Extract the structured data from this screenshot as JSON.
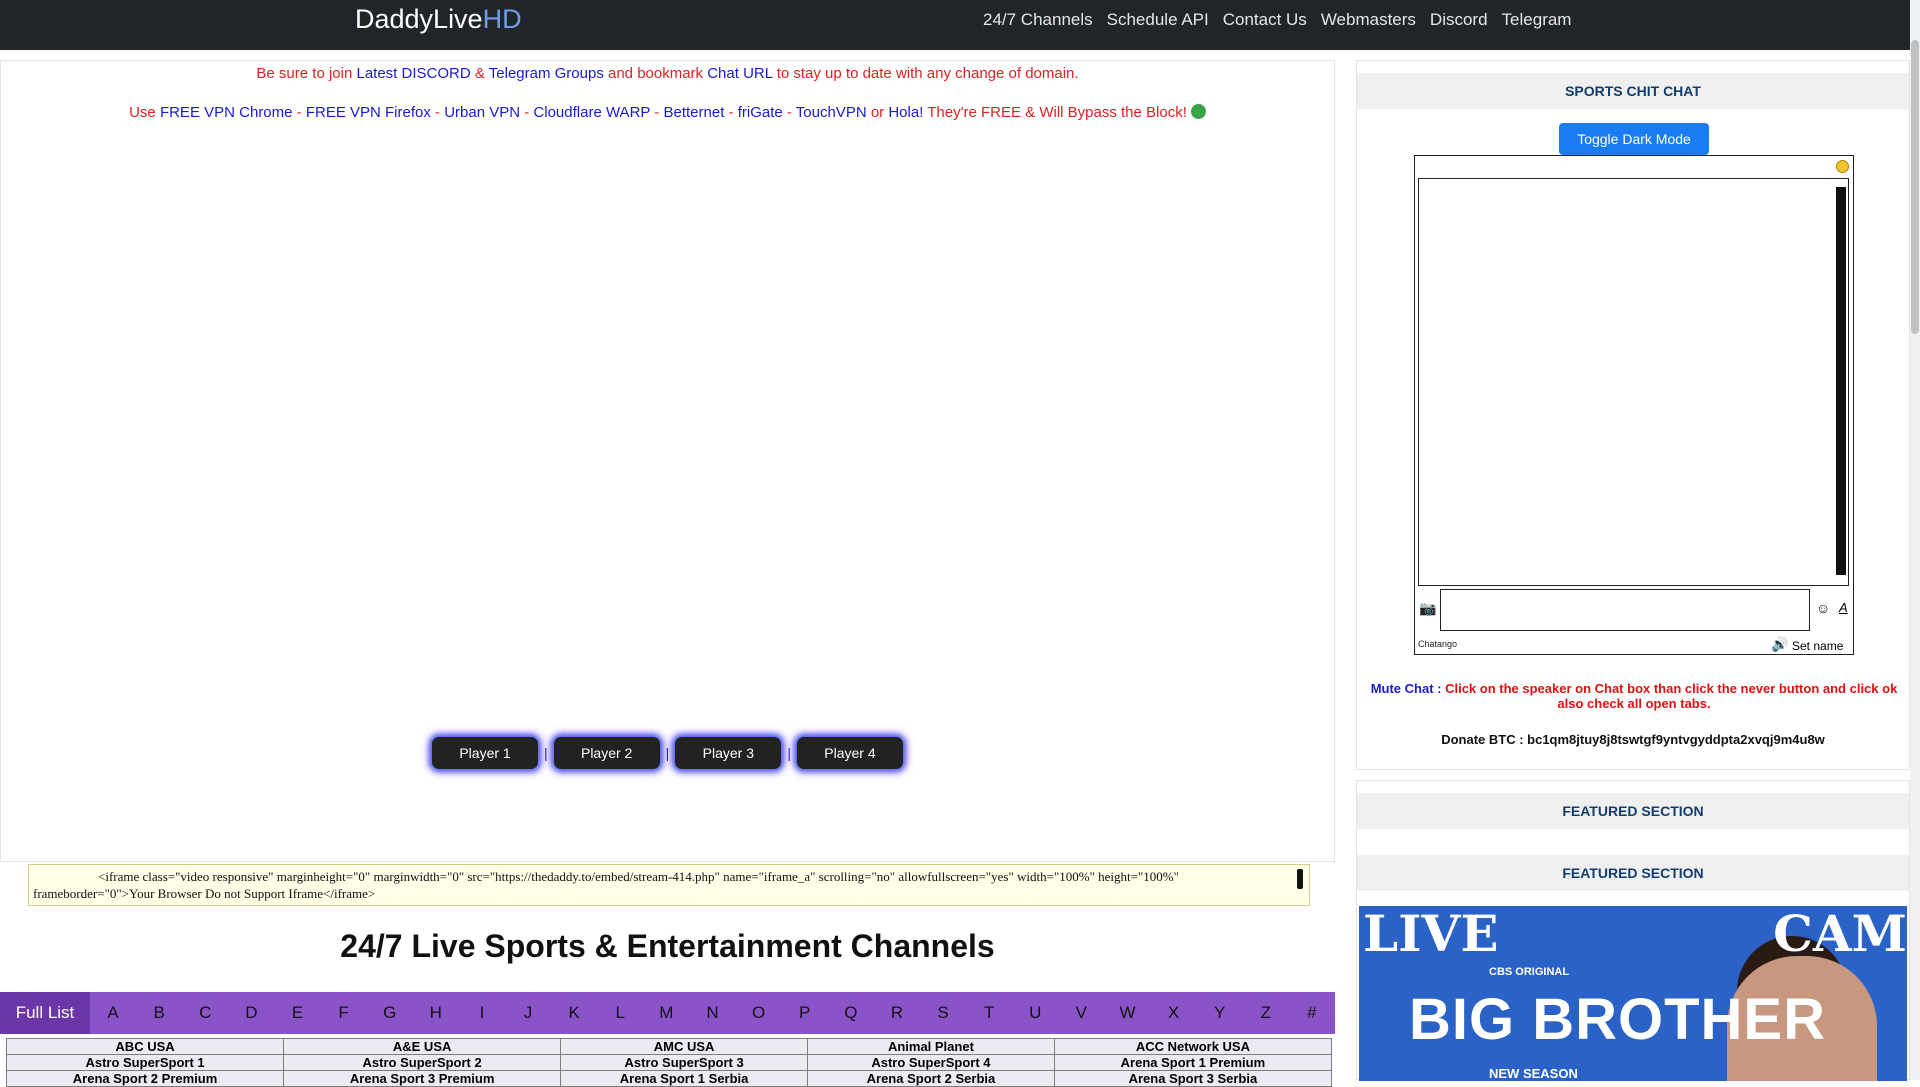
{
  "brand": {
    "name": "DaddyLive",
    "accent": "HD"
  },
  "nav": [
    "24/7 Channels",
    "Schedule API",
    "Contact Us",
    "Webmasters",
    "Discord",
    "Telegram"
  ],
  "notice1": {
    "a": "Be sure to join ",
    "discord": "Latest DISCORD",
    "amp": " & ",
    "telegram": "Telegram Groups",
    "b": " and bookmark ",
    "chat": "Chat URL",
    "c": " to stay up to date with any change of domain."
  },
  "notice2": {
    "use": "Use ",
    "links": [
      "FREE VPN Chrome",
      "FREE VPN Firefox",
      "Urban VPN",
      "Cloudflare WARP",
      "Betternet",
      "friGate",
      "TouchVPN"
    ],
    "dash": " - ",
    "or": " or ",
    "hola": "Hola!",
    "tail": " They're FREE & Will Bypass the Block!"
  },
  "players": [
    "Player 1",
    "Player 2",
    "Player 3",
    "Player 4"
  ],
  "player_sep": "|",
  "embed_code": "<iframe class=\"video responsive\" marginheight=\"0\" marginwidth=\"0\" src=\"https://thedaddy.to/embed/stream-414.php\" name=\"iframe_a\" scrolling=\"no\" allowfullscreen=\"yes\" width=\"100%\" height=\"100%\" frameborder=\"0\">Your Browser Do not Support Iframe</iframe>",
  "channels_heading": "24/7 Live Sports & Entertainment Channels",
  "alpha": [
    "Full List",
    "A",
    "B",
    "C",
    "D",
    "E",
    "F",
    "G",
    "H",
    "I",
    "J",
    "K",
    "L",
    "M",
    "N",
    "O",
    "P",
    "Q",
    "R",
    "S",
    "T",
    "U",
    "V",
    "W",
    "X",
    "Y",
    "Z",
    "#"
  ],
  "channels": [
    [
      "ABC USA",
      "A&E USA",
      "AMC USA",
      "Animal Planet",
      "ACC Network USA"
    ],
    [
      "Astro SuperSport 1",
      "Astro SuperSport 2",
      "Astro SuperSport 3",
      "Astro SuperSport 4",
      "Arena Sport 1 Premium"
    ],
    [
      "Arena Sport 2 Premium",
      "Arena Sport 3 Premium",
      "Arena Sport 1 Serbia",
      "Arena Sport 2 Serbia",
      "Arena Sport 3 Serbia"
    ]
  ],
  "sidebar": {
    "chat_title": "SPORTS CHIT CHAT",
    "toggle": "Toggle Dark Mode",
    "chat_brand": "Chatango",
    "set_name": "Set name",
    "mute_label": "Mute Chat :",
    "mute_text": " Click on the speaker on Chat box than click the never button and click ok also check all open tabs.",
    "donate": "Donate BTC : bc1qm8jtuy8j8tswtgf9yntvgyddpta2xvqj9m4u8w",
    "featured1": "FEATURED SECTION",
    "featured2": "FEATURED SECTION"
  },
  "banner": {
    "live": "LIVE",
    "cam": "CAM",
    "network": "CBS ORIGINAL",
    "show": "BIG BROTHER",
    "season": "NEW SEASON"
  },
  "colors": {
    "navbar": "#212529",
    "alpha_bar": "#8a54c8",
    "toggle": "#1a7cf2",
    "notice_red": "#dd2222",
    "link_blue": "#1a1ad6"
  },
  "icons": [
    "camera-icon",
    "smiley-icon",
    "format-icon",
    "speaker-icon",
    "status-dot-icon"
  ]
}
